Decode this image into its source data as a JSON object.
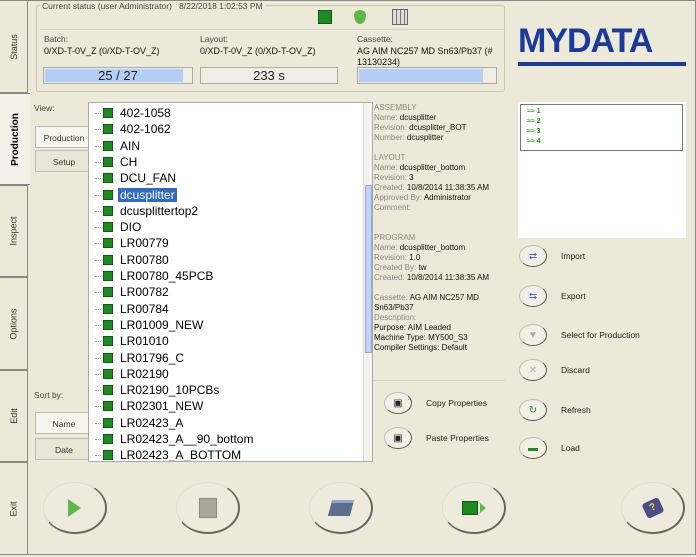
{
  "tabs": [
    {
      "label": "Status"
    },
    {
      "label": "Production",
      "active": true
    },
    {
      "label": "Inspect"
    },
    {
      "label": "Options"
    },
    {
      "label": "Edit"
    },
    {
      "label": "Exit"
    }
  ],
  "status": {
    "legend": "Current status (user Administrator)",
    "datetime": "8/22/2018 1:02:53 PM",
    "batch_label": "Batch:",
    "batch_value": "0/XD-T-0V_Z (0/XD-T-OV_Z)",
    "batch_progress": "25 / 27",
    "batch_fraction": 0.93,
    "layout_label": "Layout:",
    "layout_value": "0/XD-T-0V_Z (0/XD-T-OV_Z)",
    "layout_time": "233 s",
    "cassette_label": "Cassette:",
    "cassette_value": "AG AIM NC257 MD Sn63/Pb37 (# 13130234)",
    "cassette_fraction": 0.9
  },
  "logo": "MYDATA",
  "view": {
    "label": "View:",
    "options": [
      "Production",
      "Setup"
    ],
    "selected": "Production"
  },
  "sort": {
    "label": "Sort by:",
    "options": [
      "Name",
      "Date"
    ],
    "selected": "Name"
  },
  "list": {
    "items": [
      "402-1058",
      "402-1062",
      "AIN",
      "CH",
      "DCU_FAN",
      "dcusplitter",
      "dcusplittertop2",
      "DIO",
      "LR00779",
      "LR00780",
      "LR00780_45PCB",
      "LR00782",
      "LR00784",
      "LR01009_NEW",
      "LR01010",
      "LR01796_C",
      "LR02190",
      "LR02190_10PCBs",
      "LR02301_NEW",
      "LR02423_A",
      "LR02423_A__90_bottom",
      "LR02423_A_BOTTOM"
    ],
    "selected": "dcusplitter"
  },
  "info": {
    "assembly": {
      "heading": "ASSEMBLY",
      "name_k": "Name:",
      "name": "dcusplitter",
      "rev_k": "Revision:",
      "rev": "dcusplitter_BOT",
      "num_k": "Number:",
      "num": "dcusplitter"
    },
    "layout": {
      "heading": "LAYOUT",
      "name_k": "Name:",
      "name": "dcusplitter_bottom",
      "rev_k": "Revision:",
      "rev": "3",
      "created_k": "Created:",
      "created": "10/8/2014 11:38:35 AM",
      "appr_k": "Approved By:",
      "appr": "Administrator",
      "comment_k": "Comment:"
    },
    "program": {
      "heading": "PROGRAM",
      "name_k": "Name:",
      "name": "dcusplitter_bottom",
      "rev_k": "Revision:",
      "rev": "1.0",
      "by_k": "Created By:",
      "by": "tw",
      "created_k": "Created:",
      "created": "10/8/2014 11:38:35 AM"
    },
    "cassette_k": "Cassette:",
    "cassette": "AG AIM NC257 MD Sn63/Pb37",
    "desc_k": "Description:",
    "purpose": "Purpose: AIM Leaded",
    "machine": "Machine Type: MY500_S3",
    "compiler": "Compiler Settings: Default"
  },
  "props": {
    "copy": "Copy Properties",
    "paste": "Paste Properties"
  },
  "actions": [
    {
      "label": "Import",
      "icon": "import-icon"
    },
    {
      "label": "Export",
      "icon": "export-icon"
    },
    {
      "label": "Select for Production",
      "icon": "select-icon"
    },
    {
      "label": "Discard",
      "icon": "discard-icon"
    },
    {
      "label": "Refresh",
      "icon": "refresh-icon"
    },
    {
      "label": "Load",
      "icon": "load-icon"
    }
  ],
  "preview_lines": [
    "1",
    "2",
    "3",
    "4"
  ],
  "colors": {
    "logo": "#1a3a9c",
    "progress": "#b3cff5",
    "selection": "#316ac5",
    "board": "#1f8a22"
  }
}
